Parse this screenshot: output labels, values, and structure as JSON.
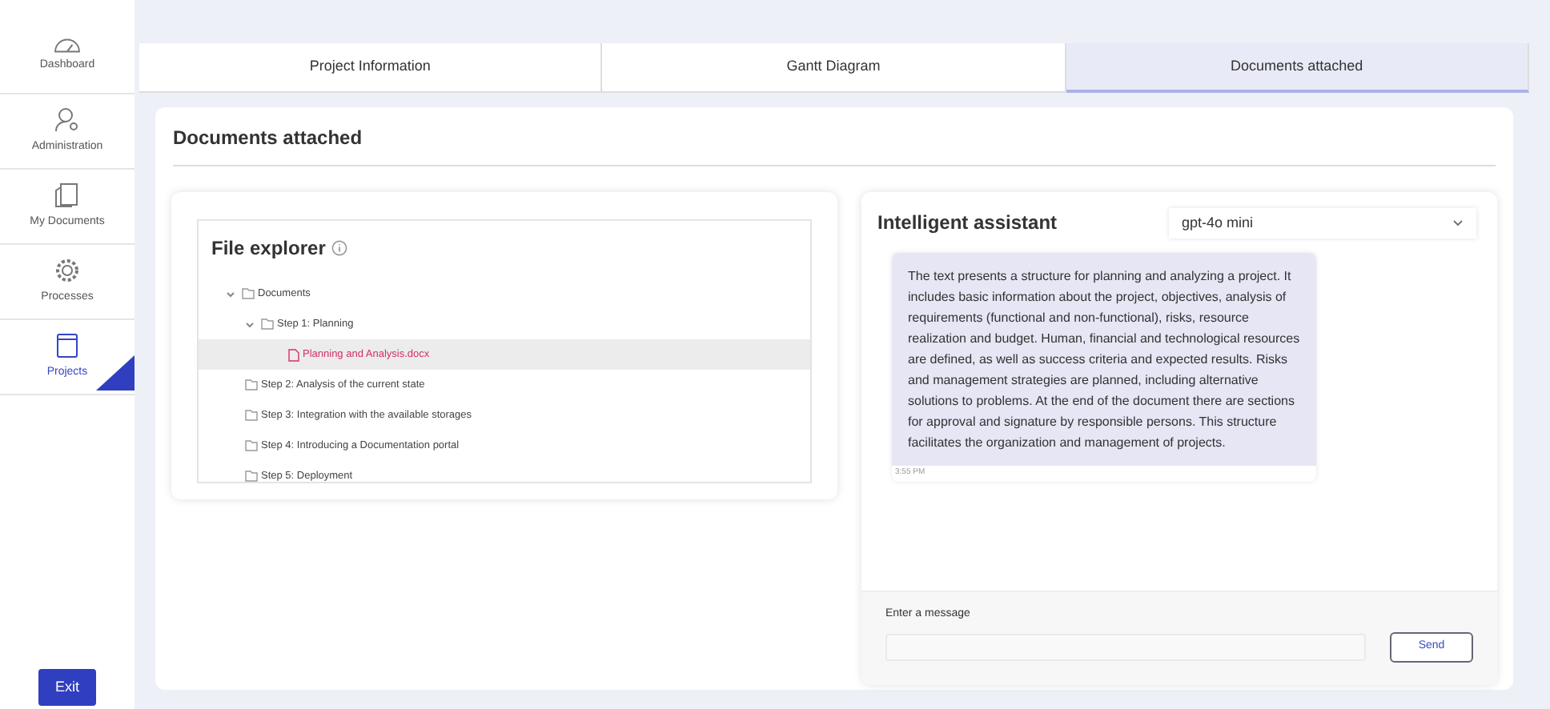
{
  "sidebar": {
    "items": [
      {
        "label": "Dashboard",
        "selected": false
      },
      {
        "label": "Administration",
        "selected": false
      },
      {
        "label": "My Documents",
        "selected": false
      },
      {
        "label": "Processes",
        "selected": false
      },
      {
        "label": "Projects",
        "selected": true
      }
    ],
    "exit_button": "Exit"
  },
  "tabs": [
    {
      "label": "Project Information",
      "selected": false
    },
    {
      "label": "Gantt Diagram",
      "selected": false
    },
    {
      "label": "Documents attached",
      "selected": true
    }
  ],
  "section_title": "Documents attached",
  "file_explorer": {
    "title": "File explorer",
    "tree": [
      {
        "label": "Documents",
        "kind": "folder",
        "expanded": true,
        "selected": false,
        "children": [
          {
            "label": "Step 1: Planning",
            "kind": "folder",
            "expanded": true,
            "selected": false,
            "children": [
              {
                "label": "Planning and Analysis.docx",
                "kind": "file",
                "selected": true
              }
            ]
          },
          {
            "label": "Step 2: Analysis of the current state",
            "kind": "folder",
            "selected": false
          },
          {
            "label": "Step 3: Integration with the available storages",
            "kind": "folder",
            "selected": false
          },
          {
            "label": "Step 4: Introducing a Documentation portal",
            "kind": "folder",
            "selected": false
          },
          {
            "label": "Step 5: Deployment",
            "kind": "folder",
            "selected": false
          }
        ]
      }
    ]
  },
  "assistant": {
    "title": "Intelligent assistant",
    "model": "gpt-4o mini",
    "messages": [
      {
        "text": "The text presents a structure for planning and analyzing a project. It includes basic information about the project, objectives, analysis of requirements (functional and non-functional), risks, resource realization and budget. Human, financial and technological resources are defined, as well as success criteria and expected results. Risks and management strategies are planned, including alternative solutions to problems. At the end of the document there are sections for approval and signature by responsible persons. This structure facilitates the organization and management of projects.",
        "time": "3:55 PM"
      }
    ],
    "input_label": "Enter a message",
    "send_button": "Send"
  }
}
